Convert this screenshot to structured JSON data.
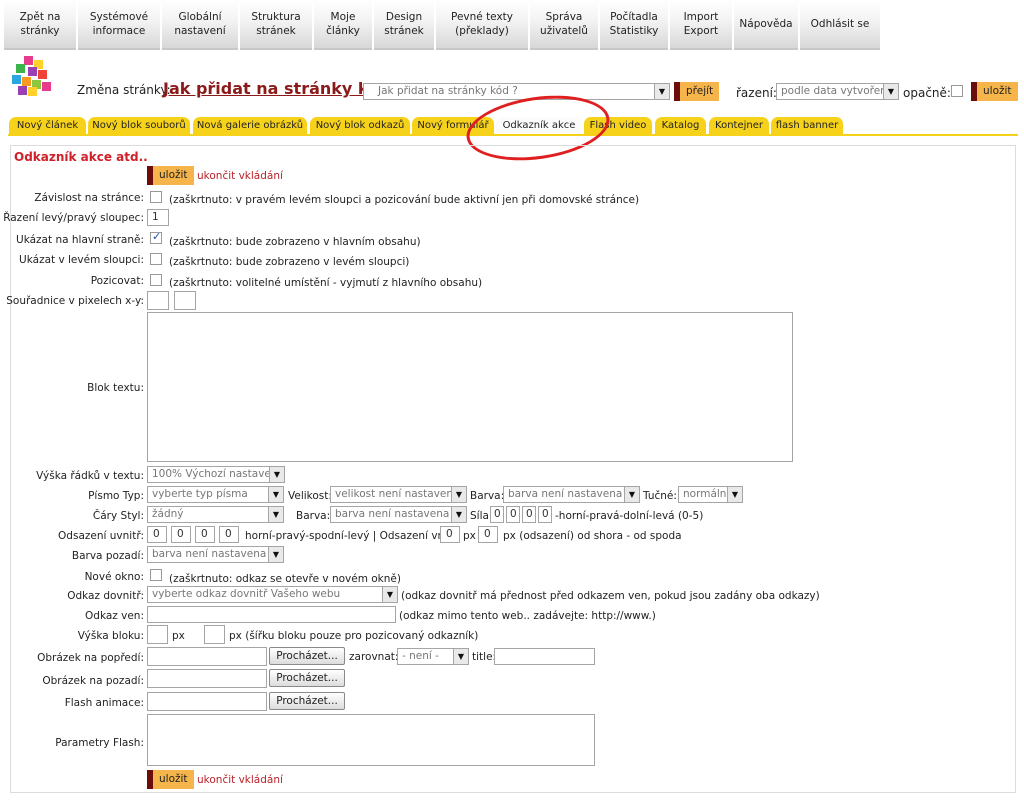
{
  "nav": [
    "Zpět na\nstránky",
    "Systémové\ninformace",
    "Globální\nnastavení",
    "Struktura\nstránek",
    "Moje\nčlánky",
    "Design\nstránek",
    "Pevné texty\n(překlady)",
    "Správa\nuživatelů",
    "Počítadla\nStatistiky",
    "Import\nExport",
    "Nápověda",
    "Odhlásit se"
  ],
  "header": {
    "zmena_label": "Změna stránky:",
    "page_title": "Jak přidat na stránky k...",
    "page_select": "Jak přidat na stránky kód ?",
    "go_button": "přejít",
    "razeni_label": "řazení:",
    "razeni_select": "podle data vytvoření",
    "opacne_label": "opačně:",
    "save_button": "uložit"
  },
  "tabs": [
    "Nový článek",
    "Nový blok souborů",
    "Nová galerie obrázků",
    "Nový blok odkazů",
    "Nový formulář",
    "Odkazník akce",
    "Flash video",
    "Katalog",
    "Kontejner",
    "flash banner"
  ],
  "panel": {
    "title": "Odkazník akce atd..",
    "save": "uložit",
    "stop": "ukončit vkládání"
  },
  "form": {
    "zavislost_label": "Závislost na stránce:",
    "zavislost_hint": "(zaškrtnuto: v pravém levém sloupci a pozicování bude aktivní jen při domovské stránce)",
    "razeni_label": "Řazení levý/pravý sloupec:",
    "razeni_value": "1",
    "hlavni_label": "Ukázat na hlavní straně:",
    "hlavni_hint": "(zaškrtnuto: bude zobrazeno v hlavním obsahu)",
    "levem_label": "Ukázat v levém sloupci:",
    "levem_hint": "(zaškrtnuto: bude zobrazeno v levém sloupci)",
    "pozicovat_label": "Pozicovat:",
    "pozicovat_hint": "(zaškrtnuto: volitelné umístění - vyjmutí z hlavního obsahu)",
    "souradnice_label": "Souřadnice v pixelech x-y:",
    "blok_label": "Blok textu:",
    "vyska_radku_label": "Výška řádků v textu:",
    "vyska_radku_value": "100% Výchozí nastaven",
    "pismo_label": "Písmo Typ:",
    "pismo_value": "vyberte typ písma",
    "velikost_label": "Velikost:",
    "velikost_value": "velikost není nastavena",
    "barva_label": "Barva:",
    "barva_value": "barva není nastavena",
    "tucne_label": "Tučné:",
    "tucne_value": "normální",
    "cary_label": "Čáry Styl:",
    "cary_value": "žádný",
    "cary_barva_label": "Barva:",
    "cary_barva_value": "barva není nastavena",
    "sila_label": "Síla:",
    "sila_values": [
      "0",
      "0",
      "0",
      "0"
    ],
    "sila_hint": "-horní-pravá-dolní-levá (0-5)",
    "odsazeni_label": "Odsazení uvnitř:",
    "odsazeni_values": [
      "0",
      "0",
      "0",
      "0"
    ],
    "odsazeni_hint": "horní-pravý-spodní-levý | Odsazení vně:",
    "vne_shora": "0",
    "vne_px": "px",
    "vne_spoda": "0",
    "vne_hint": "px (odsazení) od shora - od spoda",
    "barva_pozadi_label": "Barva pozadí:",
    "barva_pozadi_value": "barva není nastavena",
    "nove_okno_label": "Nové okno:",
    "nove_okno_hint": "(zaškrtnuto: odkaz se otevře v novém okně)",
    "dovnitr_label": "Odkaz dovnitř:",
    "dovnitr_value": "vyberte odkaz dovnitř Vašeho webu",
    "dovnitr_hint": "(odkaz dovnitř má přednost před odkazem ven, pokud jsou zadány oba odkazy)",
    "ven_label": "Odkaz ven:",
    "ven_hint": "(odkaz mimo tento web.. zadávejte: http://www.)",
    "vyska_bloku_label": "Výška bloku:",
    "px1": "px",
    "px2_hint": "px (šířku bloku pouze pro pozicovaný odkazník)",
    "popredi_label": "Obrázek na popředí:",
    "browse": "Procházet...",
    "zarovnat_label": "zarovnat:",
    "zarovnat_value": "- není -",
    "title_label": "title:",
    "pozadi_label": "Obrázek na pozadí:",
    "flash_label": "Flash animace:",
    "param_label": "Parametry Flash:"
  },
  "colors": {
    "tab": "#f7d21b",
    "save_button": "#f6b54a",
    "title_red": "#d0202a",
    "annotation": "#e02020"
  }
}
